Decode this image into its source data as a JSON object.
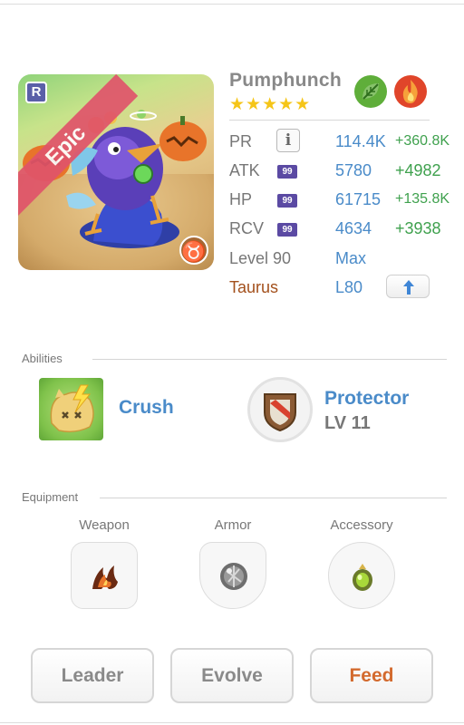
{
  "creature": {
    "name": "Pumphunch",
    "stars": "★★★★★",
    "rarity": "Epic",
    "rank_badge": "R",
    "zodiac_symbol": "♉",
    "elements": [
      "leaf-element-icon",
      "fire-element-icon"
    ]
  },
  "stats": {
    "pr": {
      "label": "PR",
      "value": "114.4K",
      "bonus": "+360.8K"
    },
    "atk": {
      "label": "ATK",
      "badge": "99",
      "value": "5780",
      "bonus": "+4982"
    },
    "hp": {
      "label": "HP",
      "badge": "99",
      "value": "61715",
      "bonus": "+135.8K"
    },
    "rcv": {
      "label": "RCV",
      "badge": "99",
      "value": "4634",
      "bonus": "+3938"
    },
    "level": {
      "label": "Level 90",
      "value": "Max"
    },
    "sign": {
      "label": "Taurus",
      "value": "L80"
    }
  },
  "abilities": {
    "title": "Abilities",
    "items": [
      {
        "name": "Crush",
        "icon": "crush-icon"
      },
      {
        "name": "Protector",
        "level": "LV 11",
        "icon": "protector-shield-icon"
      }
    ]
  },
  "equipment": {
    "title": "Equipment",
    "slots": [
      {
        "label": "Weapon",
        "icon": "fire-claw-icon"
      },
      {
        "label": "Armor",
        "icon": "silver-orb-icon"
      },
      {
        "label": "Accessory",
        "icon": "green-gem-icon"
      }
    ]
  },
  "actions": {
    "leader": "Leader",
    "evolve": "Evolve",
    "feed": "Feed"
  },
  "colors": {
    "accent_blue": "#4a8bc9",
    "bonus_green": "#3fa14e",
    "feed_orange": "#d36a2e",
    "taurus_brown": "#a3501c",
    "star_gold": "#f5c518",
    "epic_ribbon": "#e0546a"
  }
}
